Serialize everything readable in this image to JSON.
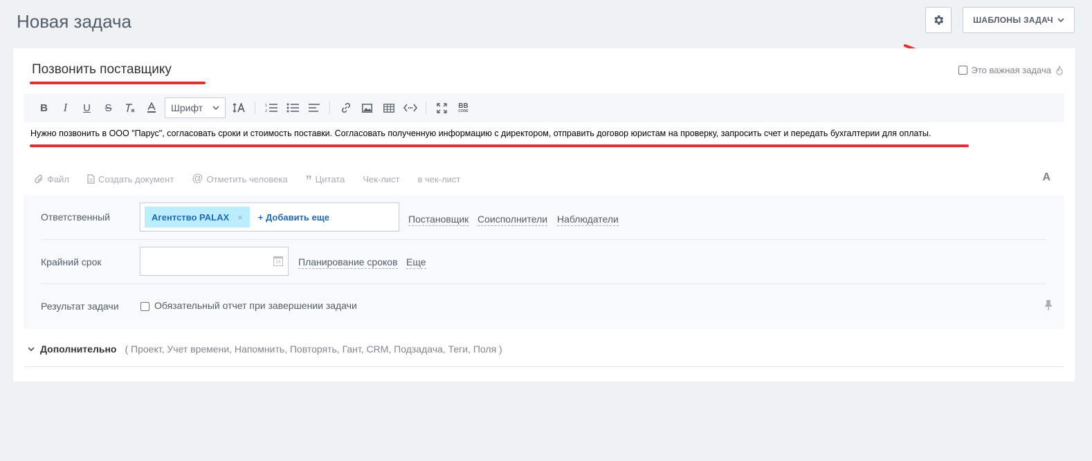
{
  "header": {
    "title": "Новая задача",
    "templates_label": "ШАБЛОНЫ ЗАДАЧ"
  },
  "task": {
    "title": "Позвонить поставщику",
    "important_label": "Это важная задача",
    "description": "Нужно позвонить в ООО \"Парус\", согласовать сроки и стоимость поставки. Согласовать полученную информацию с директором, отправить договор юристам на проверку, запросить счет и передать бухгалтерии для оплаты."
  },
  "toolbar": {
    "bold": "B",
    "italic": "I",
    "underline": "U",
    "strike": "S",
    "font_select": "Шрифт",
    "bbcode_top": "BB",
    "bbcode_bottom": "CODE"
  },
  "attach": {
    "file": "Файл",
    "create_doc": "Создать документ",
    "mention": "Отметить человека",
    "quote": "Цитата",
    "checklist": "Чек-лист",
    "to_checklist": "в чек-лист",
    "font_toggle": "A"
  },
  "fields": {
    "responsible_label": "Ответственный",
    "responsible_chip": "Агентство PALAX",
    "chip_remove": "×",
    "add_more": "+ Добавить еще",
    "creator_link": "Постановщик",
    "coexec_link": "Соисполнители",
    "observers_link": "Наблюдатели",
    "deadline_label": "Крайний срок",
    "deadline_value": "",
    "calendar_day": "24",
    "planning_link": "Планирование сроков",
    "more_link": "Еще",
    "result_label": "Результат задачи",
    "result_checkbox": "Обязательный отчет при завершении задачи"
  },
  "extra": {
    "title": "Дополнительно",
    "items": "( Проект,  Учет времени,  Напомнить,  Повторять,  Гант,  CRM,  Подзадача,  Теги,  Поля )"
  },
  "colors": {
    "annotation_red": "#e03030",
    "chip_bg": "#bcedfc",
    "link_blue": "#2067b0"
  }
}
